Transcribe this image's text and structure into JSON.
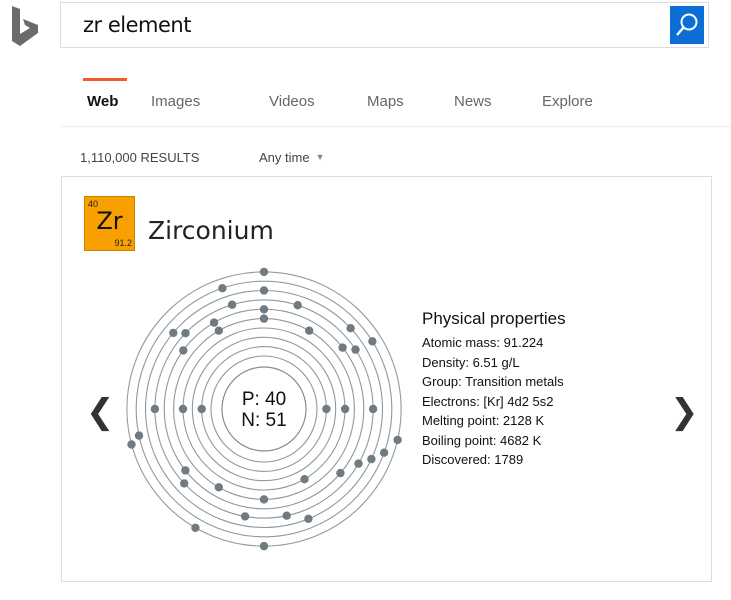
{
  "search": {
    "query": "zr element",
    "button_icon": "search-icon"
  },
  "logo": {
    "icon": "bing-logo-icon"
  },
  "tabs": [
    {
      "label": "Web",
      "active": true
    },
    {
      "label": "Images",
      "active": false
    },
    {
      "label": "Videos",
      "active": false
    },
    {
      "label": "Maps",
      "active": false
    },
    {
      "label": "News",
      "active": false
    },
    {
      "label": "Explore",
      "active": false
    }
  ],
  "results": {
    "count_label": "1,110,000 RESULTS",
    "time_filter": "Any time"
  },
  "element": {
    "atomic_number": "40",
    "symbol": "Zr",
    "mass_short": "91.2",
    "name": "Zirconium",
    "protons_label": "P: 40",
    "neutrons_label": "N: 51",
    "tile_color": "#f7a000",
    "electron_count": 40,
    "ring_count": 10
  },
  "properties": {
    "title": "Physical properties",
    "rows": [
      "Atomic mass: 91.224",
      "Density: 6.51 g/L",
      "Group: Transition metals",
      "Electrons: [Kr] 4d2 5s2",
      "Melting point: 2128 K",
      "Boiling point: 4682 K",
      "Discovered: 1789"
    ]
  },
  "nav": {
    "prev": "❮",
    "next": "❯"
  },
  "colors": {
    "accent": "#f15a29",
    "search_button": "#0c6fd6",
    "orbit": "#8f9a9e",
    "electron": "#6f7b80"
  }
}
